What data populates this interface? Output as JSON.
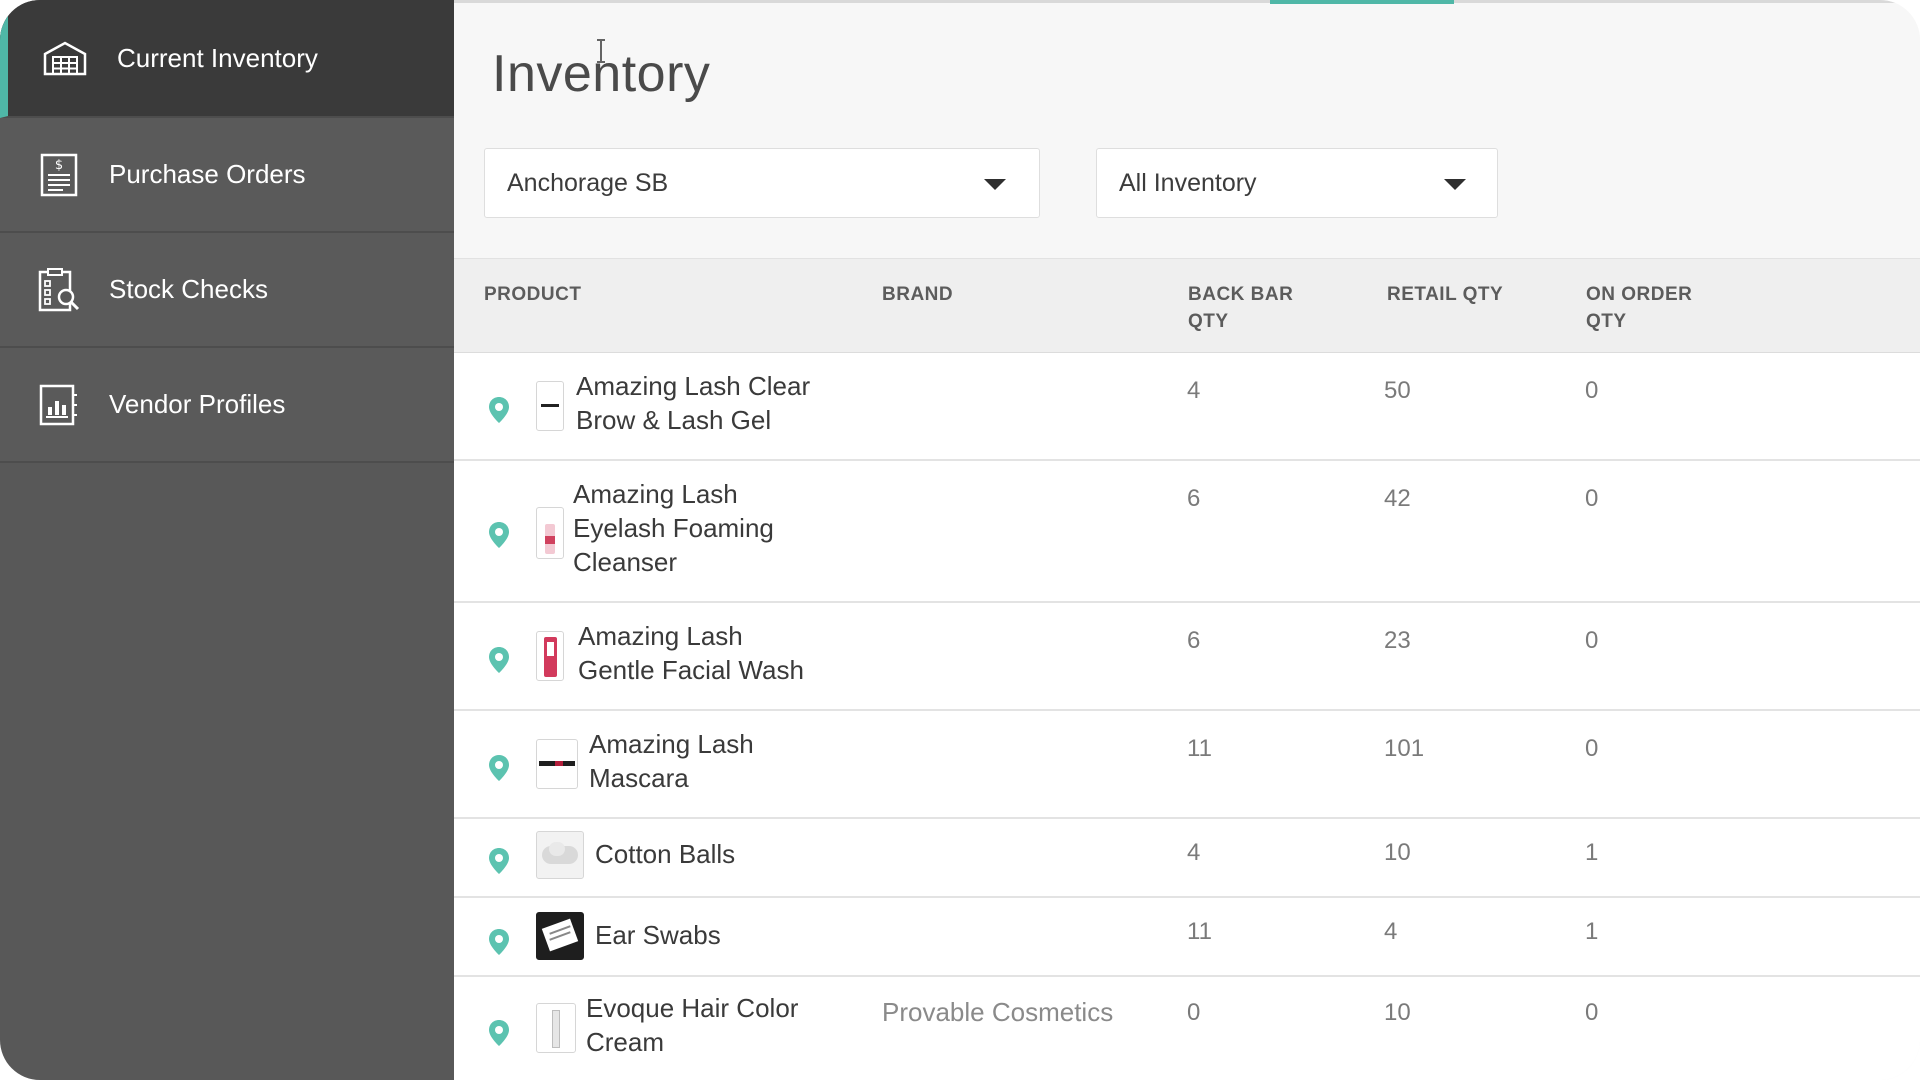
{
  "sidebar": {
    "items": [
      {
        "label": "Current Inventory",
        "icon": "warehouse-icon",
        "active": true
      },
      {
        "label": "Purchase Orders",
        "icon": "invoice-icon",
        "active": false
      },
      {
        "label": "Stock Checks",
        "icon": "clipboard-search-icon",
        "active": false
      },
      {
        "label": "Vendor Profiles",
        "icon": "vendor-chart-icon",
        "active": false
      }
    ]
  },
  "main": {
    "title": "Inventory",
    "location_select": {
      "value": "Anchorage SB"
    },
    "inventory_select": {
      "value": "All Inventory"
    },
    "table": {
      "columns": {
        "product": "PRODUCT",
        "brand": "BRAND",
        "back_bar_qty_1": "BACK BAR",
        "back_bar_qty_2": "QTY",
        "retail_qty": "RETAIL QTY",
        "on_order_qty_1": "ON ORDER",
        "on_order_qty_2": "QTY"
      },
      "rows": [
        {
          "name_1": "Amazing Lash Clear",
          "name_2": "Brow & Lash Gel",
          "name_3": "",
          "brand": "",
          "back_bar": "4",
          "retail": "50",
          "on_order": "0"
        },
        {
          "name_1": "Amazing Lash",
          "name_2": "Eyelash Foaming",
          "name_3": "Cleanser",
          "brand": "",
          "back_bar": "6",
          "retail": "42",
          "on_order": "0"
        },
        {
          "name_1": "Amazing Lash",
          "name_2": "Gentle Facial Wash",
          "name_3": "",
          "brand": "",
          "back_bar": "6",
          "retail": "23",
          "on_order": "0"
        },
        {
          "name_1": "Amazing Lash",
          "name_2": "Mascara",
          "name_3": "",
          "brand": "",
          "back_bar": "11",
          "retail": "101",
          "on_order": "0"
        },
        {
          "name_1": "Cotton Balls",
          "name_2": "",
          "name_3": "",
          "brand": "",
          "back_bar": "4",
          "retail": "10",
          "on_order": "1"
        },
        {
          "name_1": "Ear Swabs",
          "name_2": "",
          "name_3": "",
          "brand": "",
          "back_bar": "11",
          "retail": "4",
          "on_order": "1"
        },
        {
          "name_1": "Evoque Hair Color",
          "name_2": "Cream",
          "name_3": "",
          "brand": "Provable Cosmetics",
          "back_bar": "0",
          "retail": "10",
          "on_order": "0"
        }
      ]
    }
  },
  "colors": {
    "accent": "#4fb7a7",
    "sidebar": "#585858",
    "sidebar_active": "#3a3a3a"
  }
}
